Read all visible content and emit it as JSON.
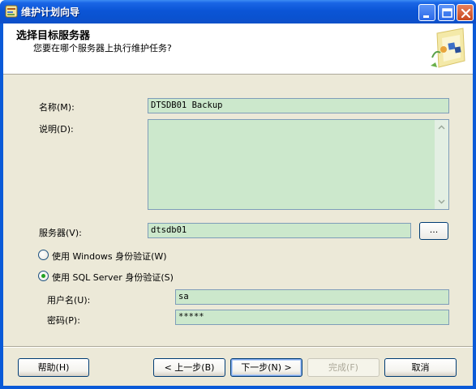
{
  "window": {
    "title": "维护计划向导"
  },
  "header": {
    "title": "选择目标服务器",
    "subtitle": "您要在哪个服务器上执行维护任务?"
  },
  "form": {
    "name_label": "名称(M):",
    "name_value": "DTSDB01 Backup",
    "description_label": "说明(D):",
    "description_value": "",
    "server_label": "服务器(V):",
    "server_value": "dtsdb01",
    "browse_label": "...",
    "auth_windows_label": "使用 Windows 身份验证(W)",
    "auth_windows_selected": false,
    "auth_sql_label": "使用 SQL Server 身份验证(S)",
    "auth_sql_selected": true,
    "username_label": "用户名(U):",
    "username_value": "sa",
    "password_label": "密码(P):",
    "password_value": "*****"
  },
  "buttons": {
    "help": "帮助(H)",
    "back": "< 上一步(B)",
    "next": "下一步(N) >",
    "finish": "完成(F)",
    "cancel": "取消"
  },
  "colors": {
    "titlebar": "#0a52d0",
    "field_bg": "#cce8cc",
    "dialog_bg": "#ece9d8",
    "radio_dot": "#21a121"
  },
  "icons": {
    "app": "wizard-icon",
    "minimize": "minimize-icon",
    "maximize": "maximize-icon",
    "close": "close-icon",
    "header_graphic": "wizard-graphic-icon",
    "scroll_up": "scroll-up-arrow-icon",
    "scroll_down": "scroll-down-arrow-icon"
  }
}
